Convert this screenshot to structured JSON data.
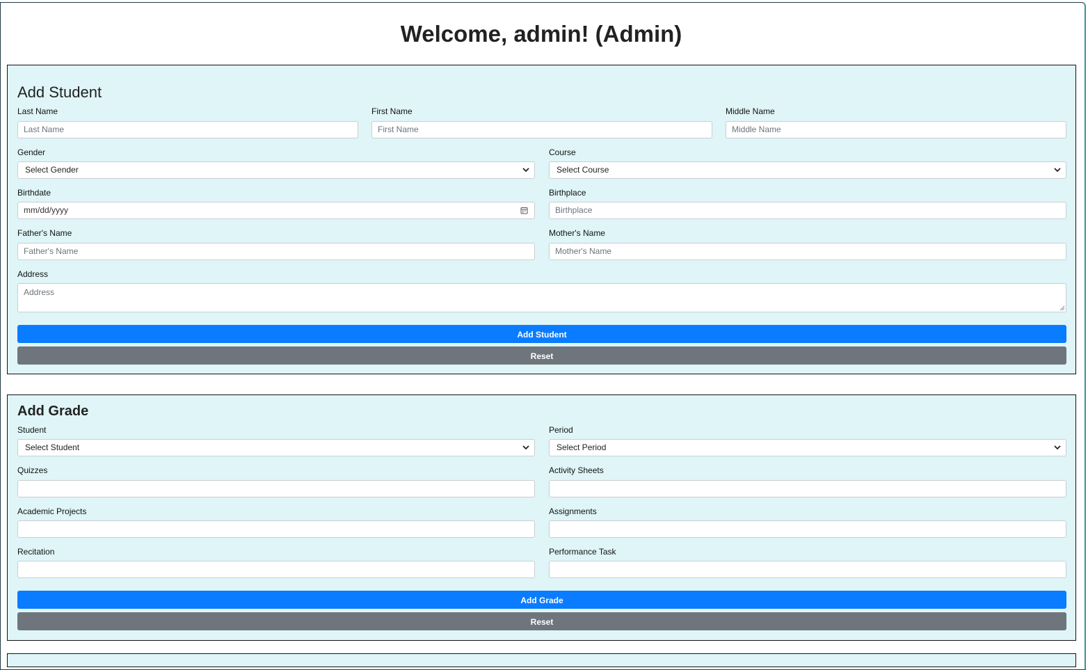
{
  "page_title": "Welcome, admin! (Admin)",
  "add_student": {
    "title": "Add Student",
    "last_name": {
      "label": "Last Name",
      "placeholder": "Last Name"
    },
    "first_name": {
      "label": "First Name",
      "placeholder": "First Name"
    },
    "middle_name": {
      "label": "Middle Name",
      "placeholder": "Middle Name"
    },
    "gender": {
      "label": "Gender",
      "selected": "Select Gender"
    },
    "course": {
      "label": "Course",
      "selected": "Select Course"
    },
    "birthdate": {
      "label": "Birthdate",
      "placeholder": "mm/dd/yyyy"
    },
    "birthplace": {
      "label": "Birthplace",
      "placeholder": "Birthplace"
    },
    "fathers_name": {
      "label": "Father's Name",
      "placeholder": "Father's Name"
    },
    "mothers_name": {
      "label": "Mother's Name",
      "placeholder": "Mother's Name"
    },
    "address": {
      "label": "Address",
      "placeholder": "Address"
    },
    "submit_label": "Add Student",
    "reset_label": "Reset"
  },
  "add_grade": {
    "title": "Add Grade",
    "student": {
      "label": "Student",
      "selected": "Select Student"
    },
    "period": {
      "label": "Period",
      "selected": "Select Period"
    },
    "quizzes": {
      "label": "Quizzes",
      "value": ""
    },
    "activity_sheets": {
      "label": "Activity Sheets",
      "value": ""
    },
    "academic_projects": {
      "label": "Academic Projects",
      "value": ""
    },
    "assignments": {
      "label": "Assignments",
      "value": ""
    },
    "recitation": {
      "label": "Recitation",
      "value": ""
    },
    "performance_task": {
      "label": "Performance Task",
      "value": ""
    },
    "submit_label": "Add Grade",
    "reset_label": "Reset"
  },
  "colors": {
    "panel_bg": "#dff5f7",
    "primary": "#0a7cff",
    "secondary": "#6e757d"
  }
}
